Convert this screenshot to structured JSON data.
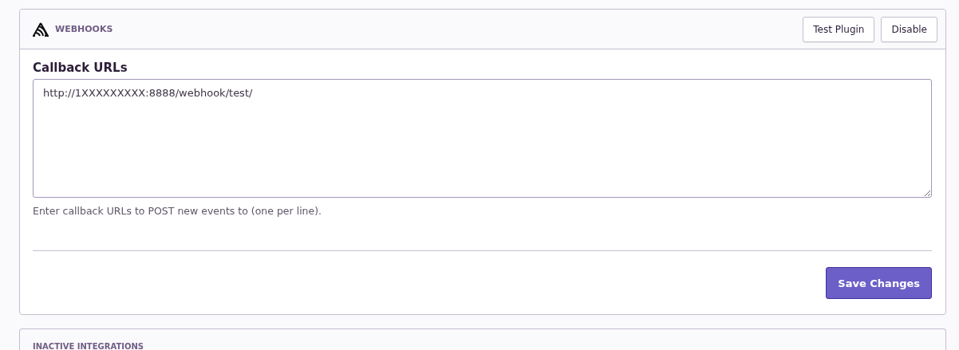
{
  "panel": {
    "title": "WEBHOOKS",
    "actions": [
      {
        "label": "Test Plugin"
      },
      {
        "label": "Disable"
      }
    ]
  },
  "field": {
    "label": "Callback URLs",
    "value": "http://1XXXXXXXXX:8888/webhook/test/",
    "help": "Enter callback URLs to POST new events to (one per line)."
  },
  "save_button": {
    "label": "Save Changes"
  },
  "next_panel": {
    "title": "INACTIVE INTEGRATIONS"
  }
}
